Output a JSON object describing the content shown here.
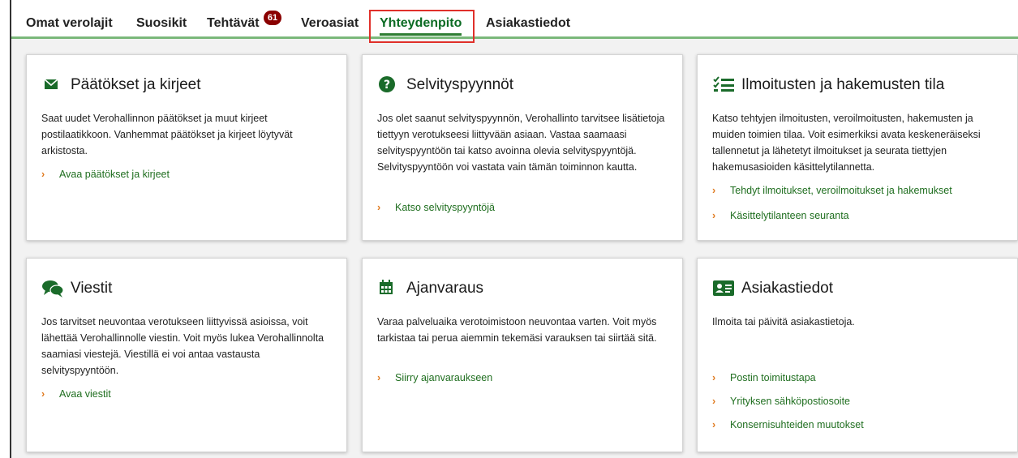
{
  "nav": {
    "items": [
      "Omat verolajit",
      "Suosikit",
      "Tehtävät",
      "Veroasiat",
      "Yhteydenpito",
      "Asiakastiedot"
    ],
    "tasks_badge": "61",
    "active": "Yhteydenpito"
  },
  "colors": {
    "link": "#1f6e1f",
    "chevron": "#e07a1f",
    "icon": "#1a6b2a",
    "badge": "#8a0000",
    "highlight": "#e0302a"
  },
  "cards": [
    {
      "title": "Päätökset ja kirjeet",
      "icon": "envelope-icon",
      "description": "Saat uudet Verohallinnon päätökset ja muut kirjeet postilaatikkoon. Vanhemmat päätökset ja kirjeet löytyvät arkistosta.",
      "links": [
        "Avaa päätökset ja kirjeet"
      ]
    },
    {
      "title": "Selvityspyynnöt",
      "icon": "question-icon",
      "description": "Jos olet saanut selvityspyynnön, Verohallinto tarvitsee lisätietoja tiettyyn verotukseesi liittyvään asiaan. Vastaa saamaasi selvityspyyntöön tai katso avoinna olevia selvityspyyntöjä. Selvityspyyntöön voi vastata vain tämän toiminnon kautta.",
      "links": [
        "Katso selvityspyyntöjä"
      ]
    },
    {
      "title": "Ilmoitusten ja hakemusten tila",
      "icon": "checklist-icon",
      "description": "Katso tehtyjen ilmoitusten, veroilmoitusten, hakemusten ja muiden toimien tilaa. Voit esimerkiksi avata keskeneräiseksi tallennetut ja lähetetyt ilmoitukset ja seurata tiettyjen hakemusasioiden käsittelytilannetta.",
      "links": [
        "Tehdyt ilmoitukset, veroilmoitukset ja hakemukset",
        "Käsittelytilanteen seuranta"
      ]
    },
    {
      "title": "Viestit",
      "icon": "chat-bubbles-icon",
      "description": "Jos tarvitset neuvontaa verotukseen liittyvissä asioissa, voit lähettää Verohallinnolle viestin. Voit myös lukea Verohallinnolta saamiasi viestejä. Viestillä ei voi antaa vastausta selvityspyyntöön.",
      "links": [
        "Avaa viestit"
      ]
    },
    {
      "title": "Ajanvaraus",
      "icon": "calendar-icon",
      "description": "Varaa palveluaika verotoimistoon neuvontaa varten. Voit myös tarkistaa tai perua aiemmin tekemäsi varauksen tai siirtää sitä.",
      "links": [
        "Siirry ajanvaraukseen"
      ]
    },
    {
      "title": "Asiakastiedot",
      "icon": "id-card-icon",
      "description": "Ilmoita tai päivitä asiakastietoja.",
      "links": [
        "Postin toimitustapa",
        "Yrityksen sähköpostiosoite",
        "Konsernisuhteiden muutokset"
      ]
    }
  ]
}
